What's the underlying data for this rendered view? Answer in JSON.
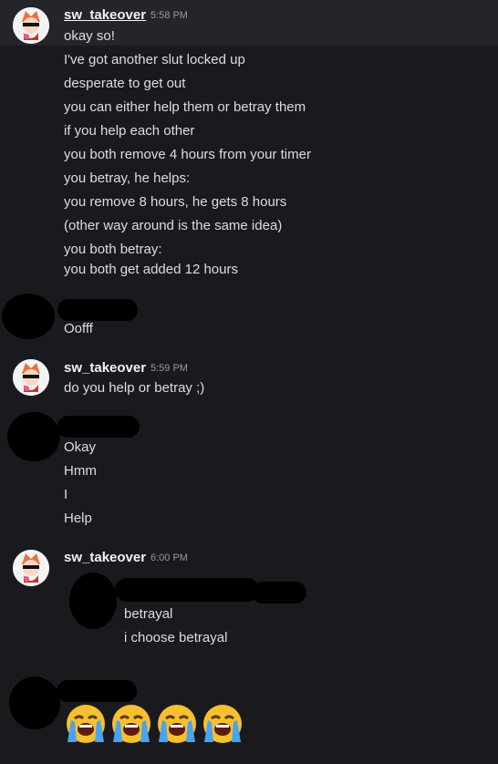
{
  "group1": {
    "username": "sw_takeover",
    "time": "5:58 PM",
    "messages": [
      "okay so!",
      "I've got another slut locked up",
      "desperate to get out",
      "you can either help them or betray them",
      "if you help each other",
      "you both remove 4 hours from your timer",
      "you betray, he helps:",
      "you remove 8 hours, he gets 8 hours",
      "(other way around is the same idea)",
      "you both betray:",
      "you both get added 12 hours"
    ]
  },
  "group2": {
    "messages": [
      "Oofff"
    ]
  },
  "group3": {
    "username": "sw_takeover",
    "time": "5:59 PM",
    "messages": [
      "do you help or betray ;)"
    ]
  },
  "group4": {
    "messages": [
      "Okay",
      "Hmm",
      "I",
      "Help"
    ]
  },
  "group5": {
    "username": "sw_takeover",
    "time": "6:00 PM",
    "messages": [
      "betrayal",
      "i choose betrayal"
    ]
  },
  "group6": {
    "emoji_count": 4,
    "emoji_icon": "loudly-crying-face-icon"
  },
  "colors": {
    "background": "#1a1a1e",
    "hover": "#242429",
    "text": "#dbdee1",
    "timestamp": "#949ba4",
    "username": "#f2f3f5",
    "avatar_accent": "#e8743b"
  }
}
